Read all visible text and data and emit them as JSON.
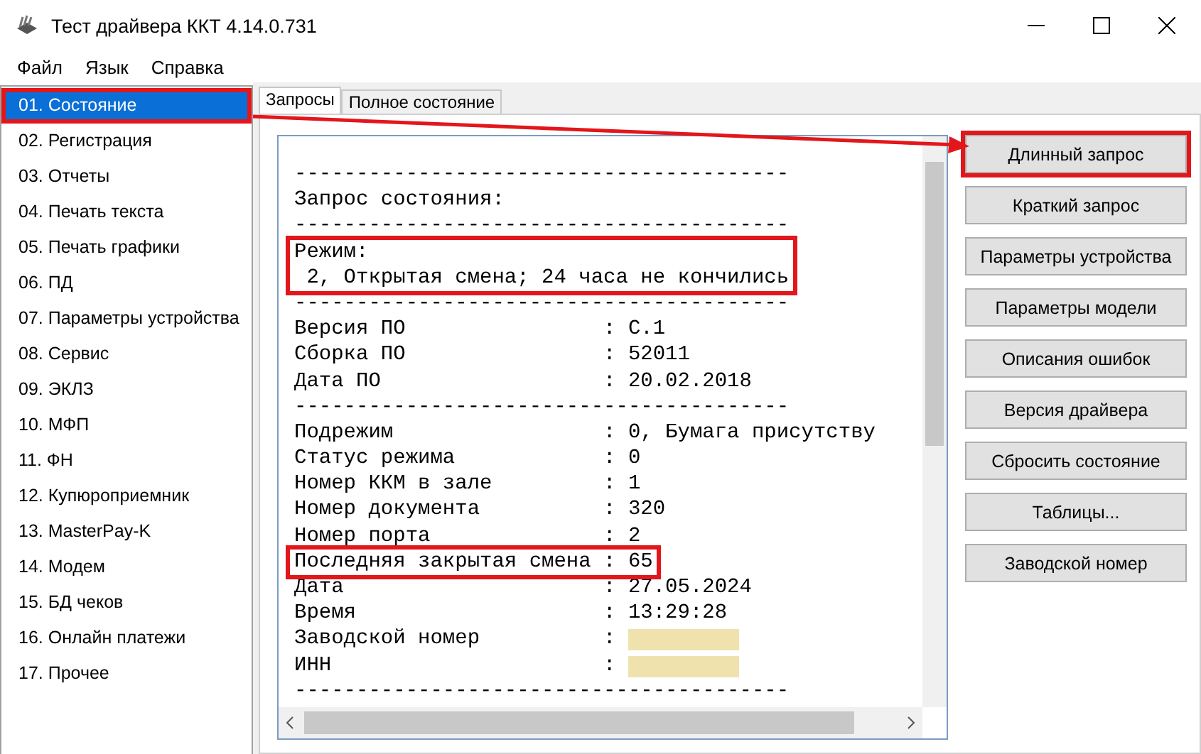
{
  "window": {
    "title": "Тест драйвера ККТ 4.14.0.731"
  },
  "menu": [
    "Файл",
    "Язык",
    "Справка"
  ],
  "sidebar": {
    "items": [
      {
        "label": "01. Состояние",
        "selected": true,
        "boxed": true
      },
      {
        "label": "02. Регистрация",
        "selected": false,
        "boxed": false
      },
      {
        "label": "03. Отчеты",
        "selected": false,
        "boxed": false
      },
      {
        "label": "04. Печать текста",
        "selected": false,
        "boxed": false
      },
      {
        "label": "05. Печать графики",
        "selected": false,
        "boxed": false
      },
      {
        "label": "06. ПД",
        "selected": false,
        "boxed": false
      },
      {
        "label": "07. Параметры устройства",
        "selected": false,
        "boxed": false
      },
      {
        "label": "08. Сервис",
        "selected": false,
        "boxed": false
      },
      {
        "label": "09. ЭКЛЗ",
        "selected": false,
        "boxed": false
      },
      {
        "label": "10. МФП",
        "selected": false,
        "boxed": false
      },
      {
        "label": "11. ФН",
        "selected": false,
        "boxed": false
      },
      {
        "label": "12. Купюроприемник",
        "selected": false,
        "boxed": false
      },
      {
        "label": "13. MasterPay-K",
        "selected": false,
        "boxed": false
      },
      {
        "label": "14. Модем",
        "selected": false,
        "boxed": false
      },
      {
        "label": "15. БД чеков",
        "selected": false,
        "boxed": false
      },
      {
        "label": "16. Онлайн платежи",
        "selected": false,
        "boxed": false
      },
      {
        "label": "17. Прочее",
        "selected": false,
        "boxed": false
      }
    ]
  },
  "tabs": [
    {
      "label": "Запросы",
      "selected": true
    },
    {
      "label": "Полное состояние",
      "selected": false
    }
  ],
  "report": {
    "blocks": [
      {
        "boxed": false,
        "lines": [
          {
            "kind": "text",
            "text": "----------------------------------------"
          },
          {
            "kind": "text",
            "text": "Запрос состояния:"
          },
          {
            "kind": "text",
            "text": "----------------------------------------"
          }
        ]
      },
      {
        "boxed": true,
        "lines": [
          {
            "kind": "text",
            "text": "Режим:"
          },
          {
            "kind": "text",
            "text": " 2, Открытая смена; 24 часа не кончились"
          }
        ]
      },
      {
        "boxed": false,
        "lines": [
          {
            "kind": "text",
            "text": "----------------------------------------"
          },
          {
            "kind": "text",
            "text": "Версия ПО                : C.1"
          },
          {
            "kind": "text",
            "text": "Сборка ПО                : 52011"
          },
          {
            "kind": "text",
            "text": "Дата ПО                  : 20.02.2018"
          },
          {
            "kind": "text",
            "text": "----------------------------------------"
          },
          {
            "kind": "text",
            "text": "Подрежим                 : 0, Бумага присутству"
          },
          {
            "kind": "text",
            "text": "Статус режима            : 0"
          },
          {
            "kind": "text",
            "text": "Номер ККМ в зале         : 1"
          },
          {
            "kind": "text",
            "text": "Номер документа          : 320"
          },
          {
            "kind": "text",
            "text": "Номер порта              : 2"
          }
        ]
      },
      {
        "boxed": true,
        "lines": [
          {
            "kind": "text",
            "text": "Последняя закрытая смена : 65"
          }
        ]
      },
      {
        "boxed": false,
        "lines": [
          {
            "kind": "text",
            "text": "Дата                     : 27.05.2024"
          },
          {
            "kind": "text",
            "text": "Время                    : 13:29:28"
          },
          {
            "kind": "redacted",
            "text": "Заводской номер          :"
          },
          {
            "kind": "redacted",
            "text": "ИНН                      :"
          },
          {
            "kind": "text",
            "text": "----------------------------------------"
          }
        ]
      }
    ]
  },
  "buttons": [
    {
      "label": "Длинный запрос",
      "boxed": true
    },
    {
      "label": "Краткий запрос",
      "boxed": false
    },
    {
      "label": "Параметры устройства",
      "boxed": false
    },
    {
      "label": "Параметры модели",
      "boxed": false
    },
    {
      "label": "Описания ошибок",
      "boxed": false
    },
    {
      "label": "Версия драйвера",
      "boxed": false
    },
    {
      "label": "Сбросить состояние",
      "boxed": false
    },
    {
      "label": "Таблицы...",
      "boxed": false
    },
    {
      "label": "Заводской номер",
      "boxed": false
    }
  ]
}
